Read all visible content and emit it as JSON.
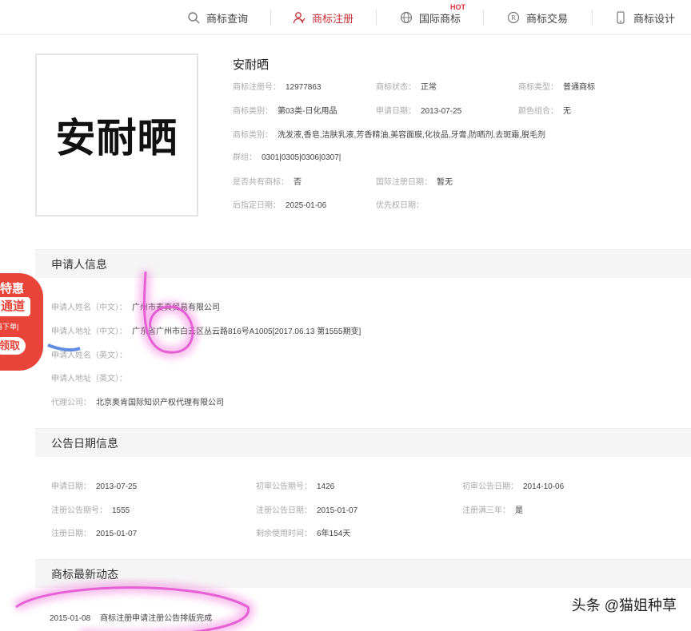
{
  "nav": {
    "items": [
      {
        "label": "商标查询",
        "icon": "search-icon"
      },
      {
        "label": "商标注册",
        "icon": "user-icon"
      },
      {
        "label": "国际商标",
        "icon": "globe-icon",
        "badge": "HOT"
      },
      {
        "label": "商标交易",
        "icon": "r-circle-icon"
      },
      {
        "label": "商标设计",
        "icon": "phone-icon"
      }
    ],
    "active_color": "#c8323a"
  },
  "mark": {
    "logo_text": "安耐晒",
    "name": "安耐晒",
    "fields": {
      "reg_no_label": "商标注册号：",
      "reg_no": "12977863",
      "status_label": "商标状态：",
      "status": "正常",
      "type_label": "商标类型：",
      "type": "普通商标",
      "class_label": "商标类别：",
      "class": "第03类-日化用品",
      "apply_date_label": "申请日期：",
      "apply_date": "2013-07-25",
      "color_label": "颜色组合：",
      "color": "无",
      "goods_label": "商标类别：",
      "goods": "洗发液,香皂,洁肤乳液,芳香精油,美容面膜,化妆品,牙膏,防晒剂,去斑霜,脱毛剂",
      "group_label": "群组：",
      "group": "0301|0305|0306|0307|",
      "shared_label": "是否共有商标：",
      "shared": "否",
      "intl_date_label": "国际注册日期：",
      "intl_date": "暂无",
      "later_date_label": "后指定日期：",
      "later_date": "2025-01-06",
      "priority_label": "优先权日期：",
      "priority": ""
    }
  },
  "applicant": {
    "title": "申请人信息",
    "name_cn_label": "申请人姓名（中文）：",
    "name_cn": "广州市麦真贸易有限公司",
    "addr_cn_label": "申请人地址（中文）：",
    "addr_cn": "广东省广州市白云区丛云路816号A1005[2017.06.13 第1555期变]",
    "name_en_label": "申请人姓名（英文）：",
    "name_en": "",
    "addr_en_label": "申请人地址（英文）：",
    "addr_en": "",
    "agent_label": "代理公司：",
    "agent": "北京奥肯国际知识产权代理有限公司"
  },
  "announce": {
    "title": "公告日期信息",
    "apply_date_label": "申请日期：",
    "apply_date": "2013-07-25",
    "prelim_no_label": "初审公告期号：",
    "prelim_no": "1426",
    "prelim_date_label": "初审公告日期：",
    "prelim_date": "2014-10-06",
    "reg_no_label": "注册公告期号：",
    "reg_no": "1555",
    "reg_date_label": "注册公告日期：",
    "reg_date": "2015-01-07",
    "three_years_label": "注册满三年：",
    "three_years": "是",
    "reg_day_label": "注册日期：",
    "reg_day": "2015-01-07",
    "remain_label": "剩余使用时间：",
    "remain": "6年154天"
  },
  "news": {
    "title": "商标最新动态",
    "items": [
      {
        "date": "2015-01-08",
        "text": "商标注册申请注册公告排版完成"
      }
    ]
  },
  "promo": {
    "line1": "特惠",
    "line2": "通道",
    "line3": "再下单|",
    "line4": "领取"
  },
  "watermark": "头条 @猫姐种草"
}
